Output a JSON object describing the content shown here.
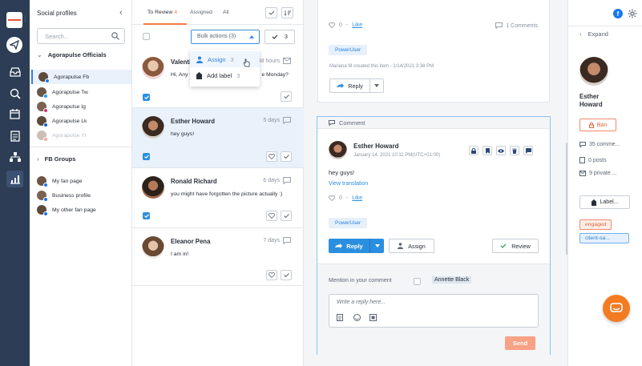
{
  "nav_rail": {
    "logo_text": "agorapulse",
    "items": [
      "compose",
      "inbox",
      "search",
      "calendar",
      "reports",
      "team",
      "analytics"
    ]
  },
  "profiles_panel": {
    "title": "Social profiles",
    "search_placeholder": "Search...",
    "groups": [
      {
        "name": "Agorapulse Officials",
        "expanded": true,
        "profiles": [
          {
            "name": "Agorapulse Fb",
            "network": "facebook",
            "selected": true
          },
          {
            "name": "Agorapulse Tw",
            "network": "twitter"
          },
          {
            "name": "Agorapulse Ig",
            "network": "instagram"
          },
          {
            "name": "Agorapulse Lk",
            "network": "linkedin"
          },
          {
            "name": "Agorapulse Yt",
            "network": "youtube",
            "dimmed": true
          }
        ]
      },
      {
        "name": "FB Groups",
        "expanded": false,
        "profiles": [
          {
            "name": "My fan page",
            "network": "facebook"
          },
          {
            "name": "Business profile",
            "network": "facebook"
          },
          {
            "name": "My other fan page",
            "network": "facebook"
          }
        ]
      }
    ]
  },
  "list_panel": {
    "tabs": [
      {
        "label": "To Review",
        "count": "4",
        "active": true
      },
      {
        "label": "Assigned"
      },
      {
        "label": "All"
      }
    ],
    "bulk_actions_label": "Bulk actions (3)",
    "check_count": "3",
    "bulk_menu": [
      {
        "label": "Assign",
        "count": "3",
        "icon": "user-icon"
      },
      {
        "label": "Add label",
        "count": "3",
        "icon": "label-icon"
      }
    ],
    "conversations": [
      {
        "name": "Valenti",
        "date": "48 hours",
        "text": "Hi, Any t",
        "text_tail": "e Monday?",
        "checked": true
      },
      {
        "name": "Esther Howard",
        "date": "5 days",
        "text": "hey guys!",
        "checked": true,
        "selected": true
      },
      {
        "name": "Ronald Richard",
        "date": "6 days",
        "text": "you might have forgotten the picture actually :)",
        "checked": true
      },
      {
        "name": "Eleanor Pena",
        "date": "7 days",
        "text": "I am in!",
        "checked": false
      }
    ]
  },
  "detail": {
    "prev_card": {
      "like_count": "0",
      "like_label": "Like",
      "comments_label": "1 Comments",
      "tag": "PowerUser",
      "created_note": "Mariana M created this item - 1/14/2021 3:38 PM",
      "reply_label": "Reply"
    },
    "comment_card": {
      "header": "Comment",
      "author": "Esther Howard",
      "timestamp": "January 14, 2021 10:11 PM(UTC+01:00)",
      "text": "hey guys!",
      "translate_label": "View translation",
      "like_count": "0",
      "like_label": "Like",
      "tag": "PowerUser",
      "reply_label": "Reply",
      "assign_label": "Assign",
      "review_label": "Review",
      "mention_label": "Mention in your comment",
      "mention_name": "Annette Black",
      "reply_placeholder": "Write a reply here...",
      "send_label": "Send"
    }
  },
  "right_panel": {
    "expand_label": "Expand",
    "name_line1": "Esther",
    "name_line2": "Howard",
    "ban_label": "Ban",
    "stats": [
      {
        "icon": "comment-icon",
        "label": "35 comme..."
      },
      {
        "icon": "post-icon",
        "label": "0 posts"
      },
      {
        "icon": "private-message-icon",
        "label": "9 private ..."
      }
    ],
    "label_button": "Label...",
    "chips": [
      {
        "label": "engaged",
        "color": "#e0633f",
        "bg": "#fdeee8",
        "border": "#f0896a"
      },
      {
        "label": "client-sa...",
        "color": "#2b7fd9",
        "bg": "#e5f0fb",
        "border": "#6fb0ec"
      }
    ]
  },
  "colors": {
    "rail": "#2c3d55",
    "accent_blue": "#2b8fe0",
    "accent_orange": "#f37c4b"
  }
}
